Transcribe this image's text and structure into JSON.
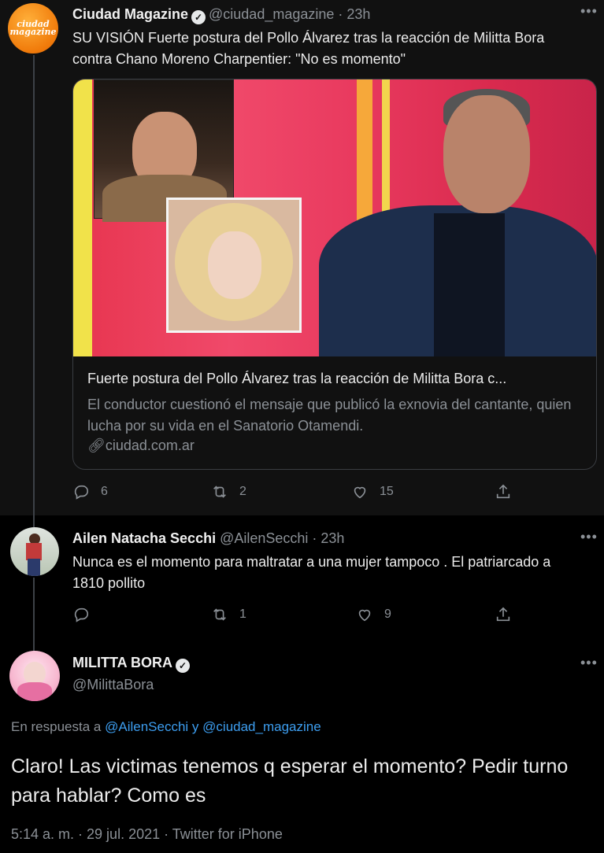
{
  "tweet1": {
    "avatar_text_line1": "ciudad",
    "avatar_text_line2": "magazine",
    "name": "Ciudad Magazine",
    "handle_time": "@ciudad_magazine · 23h",
    "text": "SU VISIÓN Fuerte postura del Pollo Álvarez tras la reacción de Militta Bora contra Chano Moreno Charpentier: \"No es momento\"",
    "card": {
      "title": "Fuerte postura del Pollo Álvarez tras la reacción de Militta Bora c...",
      "description": "El conductor cuestionó el mensaje que publicó la exnovia del cantante, quien lucha por su vida en el Sanatorio Otamendi.",
      "domain": "ciudad.com.ar"
    },
    "replies": "6",
    "retweets": "2",
    "likes": "15"
  },
  "tweet2": {
    "name": "Ailen Natacha Secchi",
    "handle_time": "@AilenSecchi · 23h",
    "text": "Nunca es el momento para maltratar a una mujer tampoco . El patriarcado a 1810 pollito",
    "replies": "",
    "retweets": "1",
    "likes": "9"
  },
  "tweet3": {
    "name": "MILITTA BORA",
    "handle": "@MilittaBora",
    "reply_prefix": "En respuesta a",
    "mention1": "@AilenSecchi",
    "reply_and": "y",
    "mention2": "@ciudad_magazine",
    "text": "Claro! Las victimas tenemos q esperar el momento? Pedir turno para hablar? Como es",
    "meta": "5:14 a. m. · 29 jul. 2021 · Twitter for iPhone"
  },
  "icons": [
    "reply-icon",
    "retweet-icon",
    "like-icon",
    "share-icon",
    "verified-icon",
    "more-icon",
    "link-icon"
  ],
  "colors": {
    "link": "#3d9ef0",
    "muted": "#8b9096",
    "brand_orange": "#f07a0a"
  }
}
